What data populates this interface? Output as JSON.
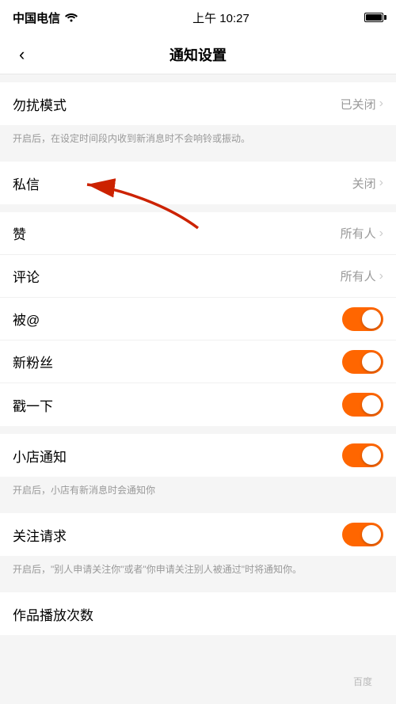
{
  "statusBar": {
    "carrier": "中国电信",
    "wifi": "WiFi",
    "time": "上午 10:27",
    "battery": "full"
  },
  "nav": {
    "backLabel": "‹",
    "title": "通知设置"
  },
  "sections": [
    {
      "id": "dnd",
      "rows": [
        {
          "label": "勿扰模式",
          "value": "已关闭",
          "type": "chevron"
        }
      ],
      "note": "开启后，在设定时间段内收到新消息时不会响铃或振动。"
    },
    {
      "id": "messages",
      "rows": [
        {
          "label": "私信",
          "value": "关闭",
          "type": "chevron"
        }
      ]
    },
    {
      "id": "interactions",
      "rows": [
        {
          "label": "赞",
          "value": "所有人",
          "type": "chevron",
          "hasArrow": true
        },
        {
          "label": "评论",
          "value": "所有人",
          "type": "chevron"
        },
        {
          "label": "被@",
          "value": "",
          "type": "toggle",
          "enabled": true
        },
        {
          "label": "新粉丝",
          "value": "",
          "type": "toggle",
          "enabled": true
        },
        {
          "label": "戳一下",
          "value": "",
          "type": "toggle",
          "enabled": true
        }
      ]
    },
    {
      "id": "shop",
      "rows": [
        {
          "label": "小店通知",
          "value": "",
          "type": "toggle",
          "enabled": true
        }
      ],
      "note": "开启后，小店有新消息时会通知你"
    },
    {
      "id": "follow",
      "rows": [
        {
          "label": "关注请求",
          "value": "",
          "type": "toggle",
          "enabled": true
        }
      ],
      "note": "开启后，\"别人申请关注你\"或者\"你申请关注别人被通过\"时将通知你。"
    },
    {
      "id": "plays",
      "rows": [
        {
          "label": "作品播放次数",
          "value": "",
          "type": "none"
        }
      ]
    }
  ],
  "watermark": "百度"
}
